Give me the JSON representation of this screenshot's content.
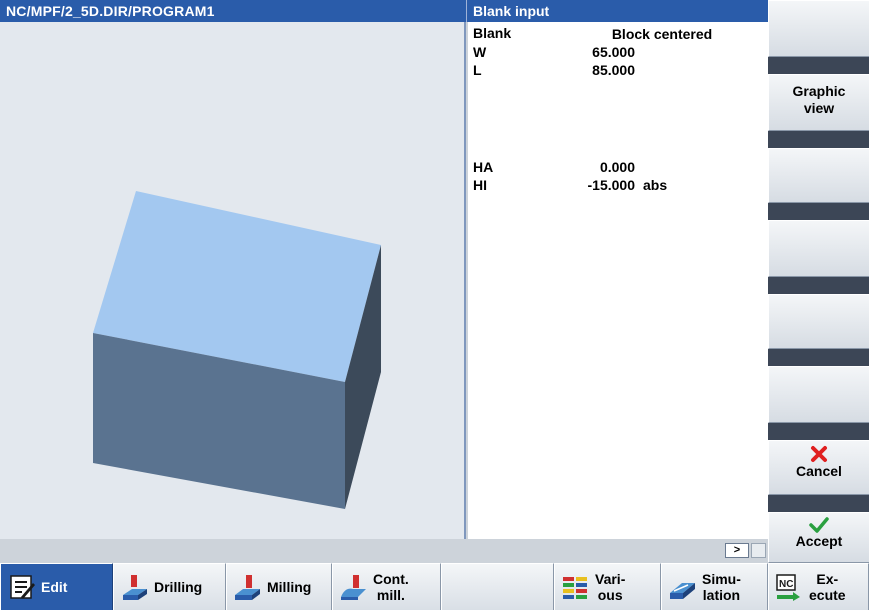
{
  "window": {
    "title": "NC/MPF/2_5D.DIR/PROGRAM1",
    "form_title": "Blank input"
  },
  "form": {
    "blank_label": "Blank",
    "blank_value": "Block centered",
    "fields": [
      {
        "label": "W",
        "value": "65.000",
        "unit": ""
      },
      {
        "label": "L",
        "value": "85.000",
        "unit": ""
      },
      {
        "label": "HA",
        "value": "0.000",
        "unit": ""
      },
      {
        "label": "HI",
        "value": "-15.000",
        "unit": "abs"
      }
    ]
  },
  "strip": {
    "more_symbol": ">"
  },
  "vertical_softkeys": [
    {
      "label": ""
    },
    {
      "label_line1": "Graphic",
      "label_line2": "view"
    },
    {
      "label": ""
    },
    {
      "label": ""
    },
    {
      "label": ""
    },
    {
      "label": ""
    },
    {
      "label": "Cancel",
      "icon": "x-icon"
    },
    {
      "label": "Accept",
      "icon": "checkmark-icon"
    }
  ],
  "horizontal_softkeys": [
    {
      "label": "Edit",
      "icon": "edit-icon",
      "active": true
    },
    {
      "label": "Drilling",
      "icon": "drilling-icon"
    },
    {
      "label": "Milling",
      "icon": "milling-icon"
    },
    {
      "label_line1": "Cont.",
      "label_line2": "mill.",
      "icon": "contour-milling-icon"
    },
    {
      "label": ""
    },
    {
      "label_line1": "Vari-",
      "label_line2": "ous",
      "icon": "various-icon"
    },
    {
      "label_line1": "Simu-",
      "label_line2": "lation",
      "icon": "simulation-icon"
    },
    {
      "label_line1": "Ex-",
      "label_line2": "ecute",
      "icon": "nc-execute-icon"
    }
  ],
  "colors": {
    "title_bar": "#2a5caa",
    "cancel_icon": "#e02020",
    "accept_icon": "#2aa040",
    "block_top": "#a3c8f0",
    "block_front": "#5a7390",
    "block_side": "#3c4a5a"
  }
}
